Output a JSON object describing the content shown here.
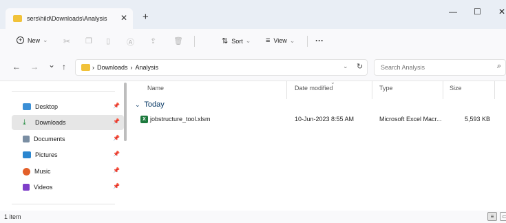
{
  "tab": {
    "title": "sers\\hild\\Downloads\\Analysis",
    "close": "✕",
    "new": "+"
  },
  "window": {
    "minimize": "—",
    "maximize": "☐",
    "close": "✕"
  },
  "toolbar": {
    "new_label": "New",
    "sort_label": "Sort",
    "view_label": "View",
    "more": "···"
  },
  "address": {
    "back": "←",
    "forward": "→",
    "recent": "⌄",
    "up": "↑",
    "crumbs": [
      "Downloads",
      "Analysis"
    ],
    "refresh": "↻",
    "search_placeholder": "Search Analysis"
  },
  "sidebar": {
    "items": [
      {
        "label": "Desktop",
        "color": "#3b8fd6"
      },
      {
        "label": "Downloads",
        "color": "#1f8a3d"
      },
      {
        "label": "Documents",
        "color": "#7a8ea3"
      },
      {
        "label": "Pictures",
        "color": "#2b86cf"
      },
      {
        "label": "Music",
        "color": "#e3602a"
      },
      {
        "label": "Videos",
        "color": "#7f3fc9"
      }
    ]
  },
  "columns": {
    "name": "Name",
    "date": "Date modified",
    "type": "Type",
    "size": "Size"
  },
  "group": {
    "label": "Today"
  },
  "files": [
    {
      "name": "jobstructure_tool.xlsm",
      "date": "10-Jun-2023 8:55 AM",
      "type": "Microsoft Excel Macr...",
      "size": "5,593 KB"
    }
  ],
  "status": {
    "count": "1 item"
  },
  "colors": {
    "accent": "#0a5fb4",
    "excel_green": "#1d7a3e",
    "folder_yellow": "#f1c23a"
  }
}
